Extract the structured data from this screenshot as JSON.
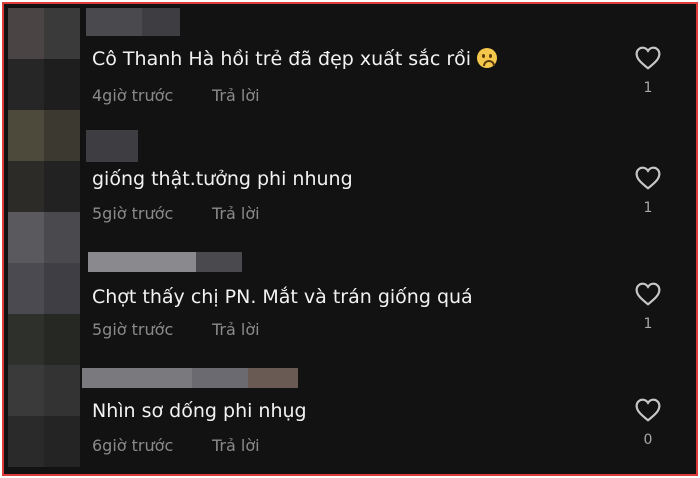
{
  "colors": {
    "background": "#121212",
    "frame_border": "#e03b3b",
    "comment_text": "#f2f2f2",
    "meta_text": "#8a8a8a",
    "count_text": "#a8a8a8"
  },
  "comments": [
    {
      "text": "Cô Thanh Hà hồi trẻ đã đẹp xuất sắc rồi",
      "emoji": "worried-face-emoji",
      "time": "4giờ trước",
      "reply_label": "Trả lời",
      "likes": "1"
    },
    {
      "text": "giống thật.tưởng phi nhung",
      "time": "5giờ trước",
      "reply_label": "Trả lời",
      "likes": "1"
    },
    {
      "text": "Chợt thấy chị PN. Mắt và trán giống quá",
      "time": "5giờ trước",
      "reply_label": "Trả lời",
      "likes": "1"
    },
    {
      "text": "Nhìn sơ dống phi nhụg",
      "time": "6giờ trước",
      "reply_label": "Trả lời",
      "likes": "0"
    }
  ],
  "icons": {
    "like": "heart-outline-icon"
  }
}
